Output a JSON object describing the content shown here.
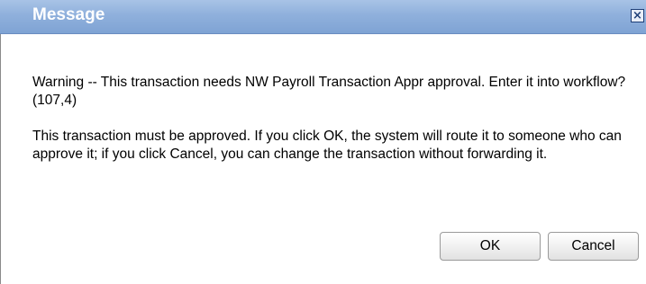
{
  "dialog": {
    "title": "Message",
    "close_icon": "close-icon",
    "warning_text": "Warning -- This transaction needs NW Payroll Transaction Appr approval.  Enter it into workflow? (107,4)",
    "info_text": "This transaction must be approved.  If you click OK, the system will route it to someone who can approve it; if you click Cancel, you can change the transaction without forwarding it.",
    "ok_label": "OK",
    "cancel_label": "Cancel"
  },
  "colors": {
    "titlebar": "#8fb0dc",
    "title_text": "#ffffff",
    "button_border": "#9a9a9a"
  }
}
